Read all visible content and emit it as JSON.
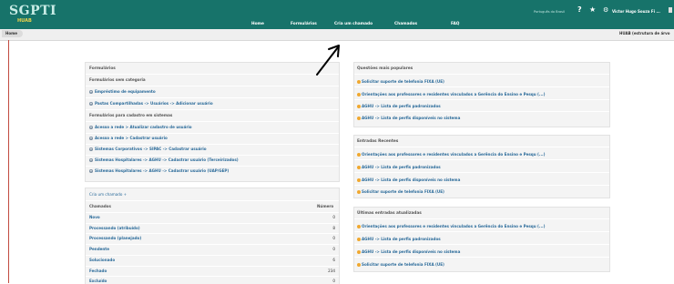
{
  "app": {
    "title": "SGPTI",
    "subtitle": "HUAB"
  },
  "header": {
    "language": "Português do Brasil",
    "help_icon": "?",
    "star_icon": "★",
    "gear_icon": "⚙",
    "user": "Victor Hugo Souza Fi ..."
  },
  "nav": [
    "Home",
    "Formulários",
    "Cria um chamado",
    "Chamados",
    "FAQ"
  ],
  "breadcrumb": {
    "home": "Home",
    "right": "HUAB (estrutura de árvo"
  },
  "forms_panel": {
    "title": "Formulários",
    "category_label": "Formulários sem categoria",
    "uncategorized": [
      "Empréstimo de equipamento",
      "Pastas Compartilhadas -> Usuários -> Adicionar usuário"
    ],
    "systems_label": "Formulários para cadastro em sistemas",
    "systems": [
      "Acesso a rede > Atualizar cadastro de usuário",
      "Acesso a rede > Cadastrar usuário",
      "Sistemas Corporativos -> SIPAC -> Cadastrar usuário",
      "Sistemas Hospitalares -> AGHU -> Cadastrar usuário (Terceirizados)",
      "Sistemas Hospitalares -> AGHU -> Cadastrar usuário (UAP/GEP)"
    ]
  },
  "tickets_panel": {
    "create_label": "Cria um chamado",
    "plus_icon": "+",
    "col_name": "Chamados",
    "col_count": "Número",
    "rows": [
      {
        "label": "Novo",
        "count": "0"
      },
      {
        "label": "Processando (atribuído)",
        "count": "8"
      },
      {
        "label": "Processando (planejado)",
        "count": "0"
      },
      {
        "label": "Pendente",
        "count": "0"
      },
      {
        "label": "Solucionado",
        "count": "6"
      },
      {
        "label": "Fechado",
        "count": "234"
      },
      {
        "label": "Excluído",
        "count": "0"
      }
    ]
  },
  "popular_panel": {
    "title": "Questões mais populares",
    "items": [
      "Solicitar suporte de telefonia FIXA (UE)",
      "Orientações aos professores e residentes vinculados a Gerência do Ensino e Pesqu (...)",
      "AGHU -> Lista de perfis padronizados",
      "AGHU -> Lista de perfis disponíveis no sistema"
    ]
  },
  "recent_panel": {
    "title": "Entradas Recentes",
    "items": [
      "Orientações aos professores e residentes vinculados a Gerência do Ensino e Pesqu (...)",
      "AGHU -> Lista de perfis padronizados",
      "AGHU -> Lista de perfis disponíveis no sistema",
      "Solicitar suporte de telefonia FIXA (UE)"
    ]
  },
  "updated_panel": {
    "title": "Últimas entradas atualizadas",
    "items": [
      "Orientações aos professores e residentes vinculados a Gerência do Ensino e Pesqu (...)",
      "AGHU -> Lista de perfis padronizados",
      "AGHU -> Lista de perfis disponíveis no sistema",
      "Solicitar suporte de telefonia FIXA (UE)"
    ]
  },
  "colors": {
    "header": "#17736a",
    "link": "#2b6b9a",
    "question_icon": "#f0a830"
  }
}
